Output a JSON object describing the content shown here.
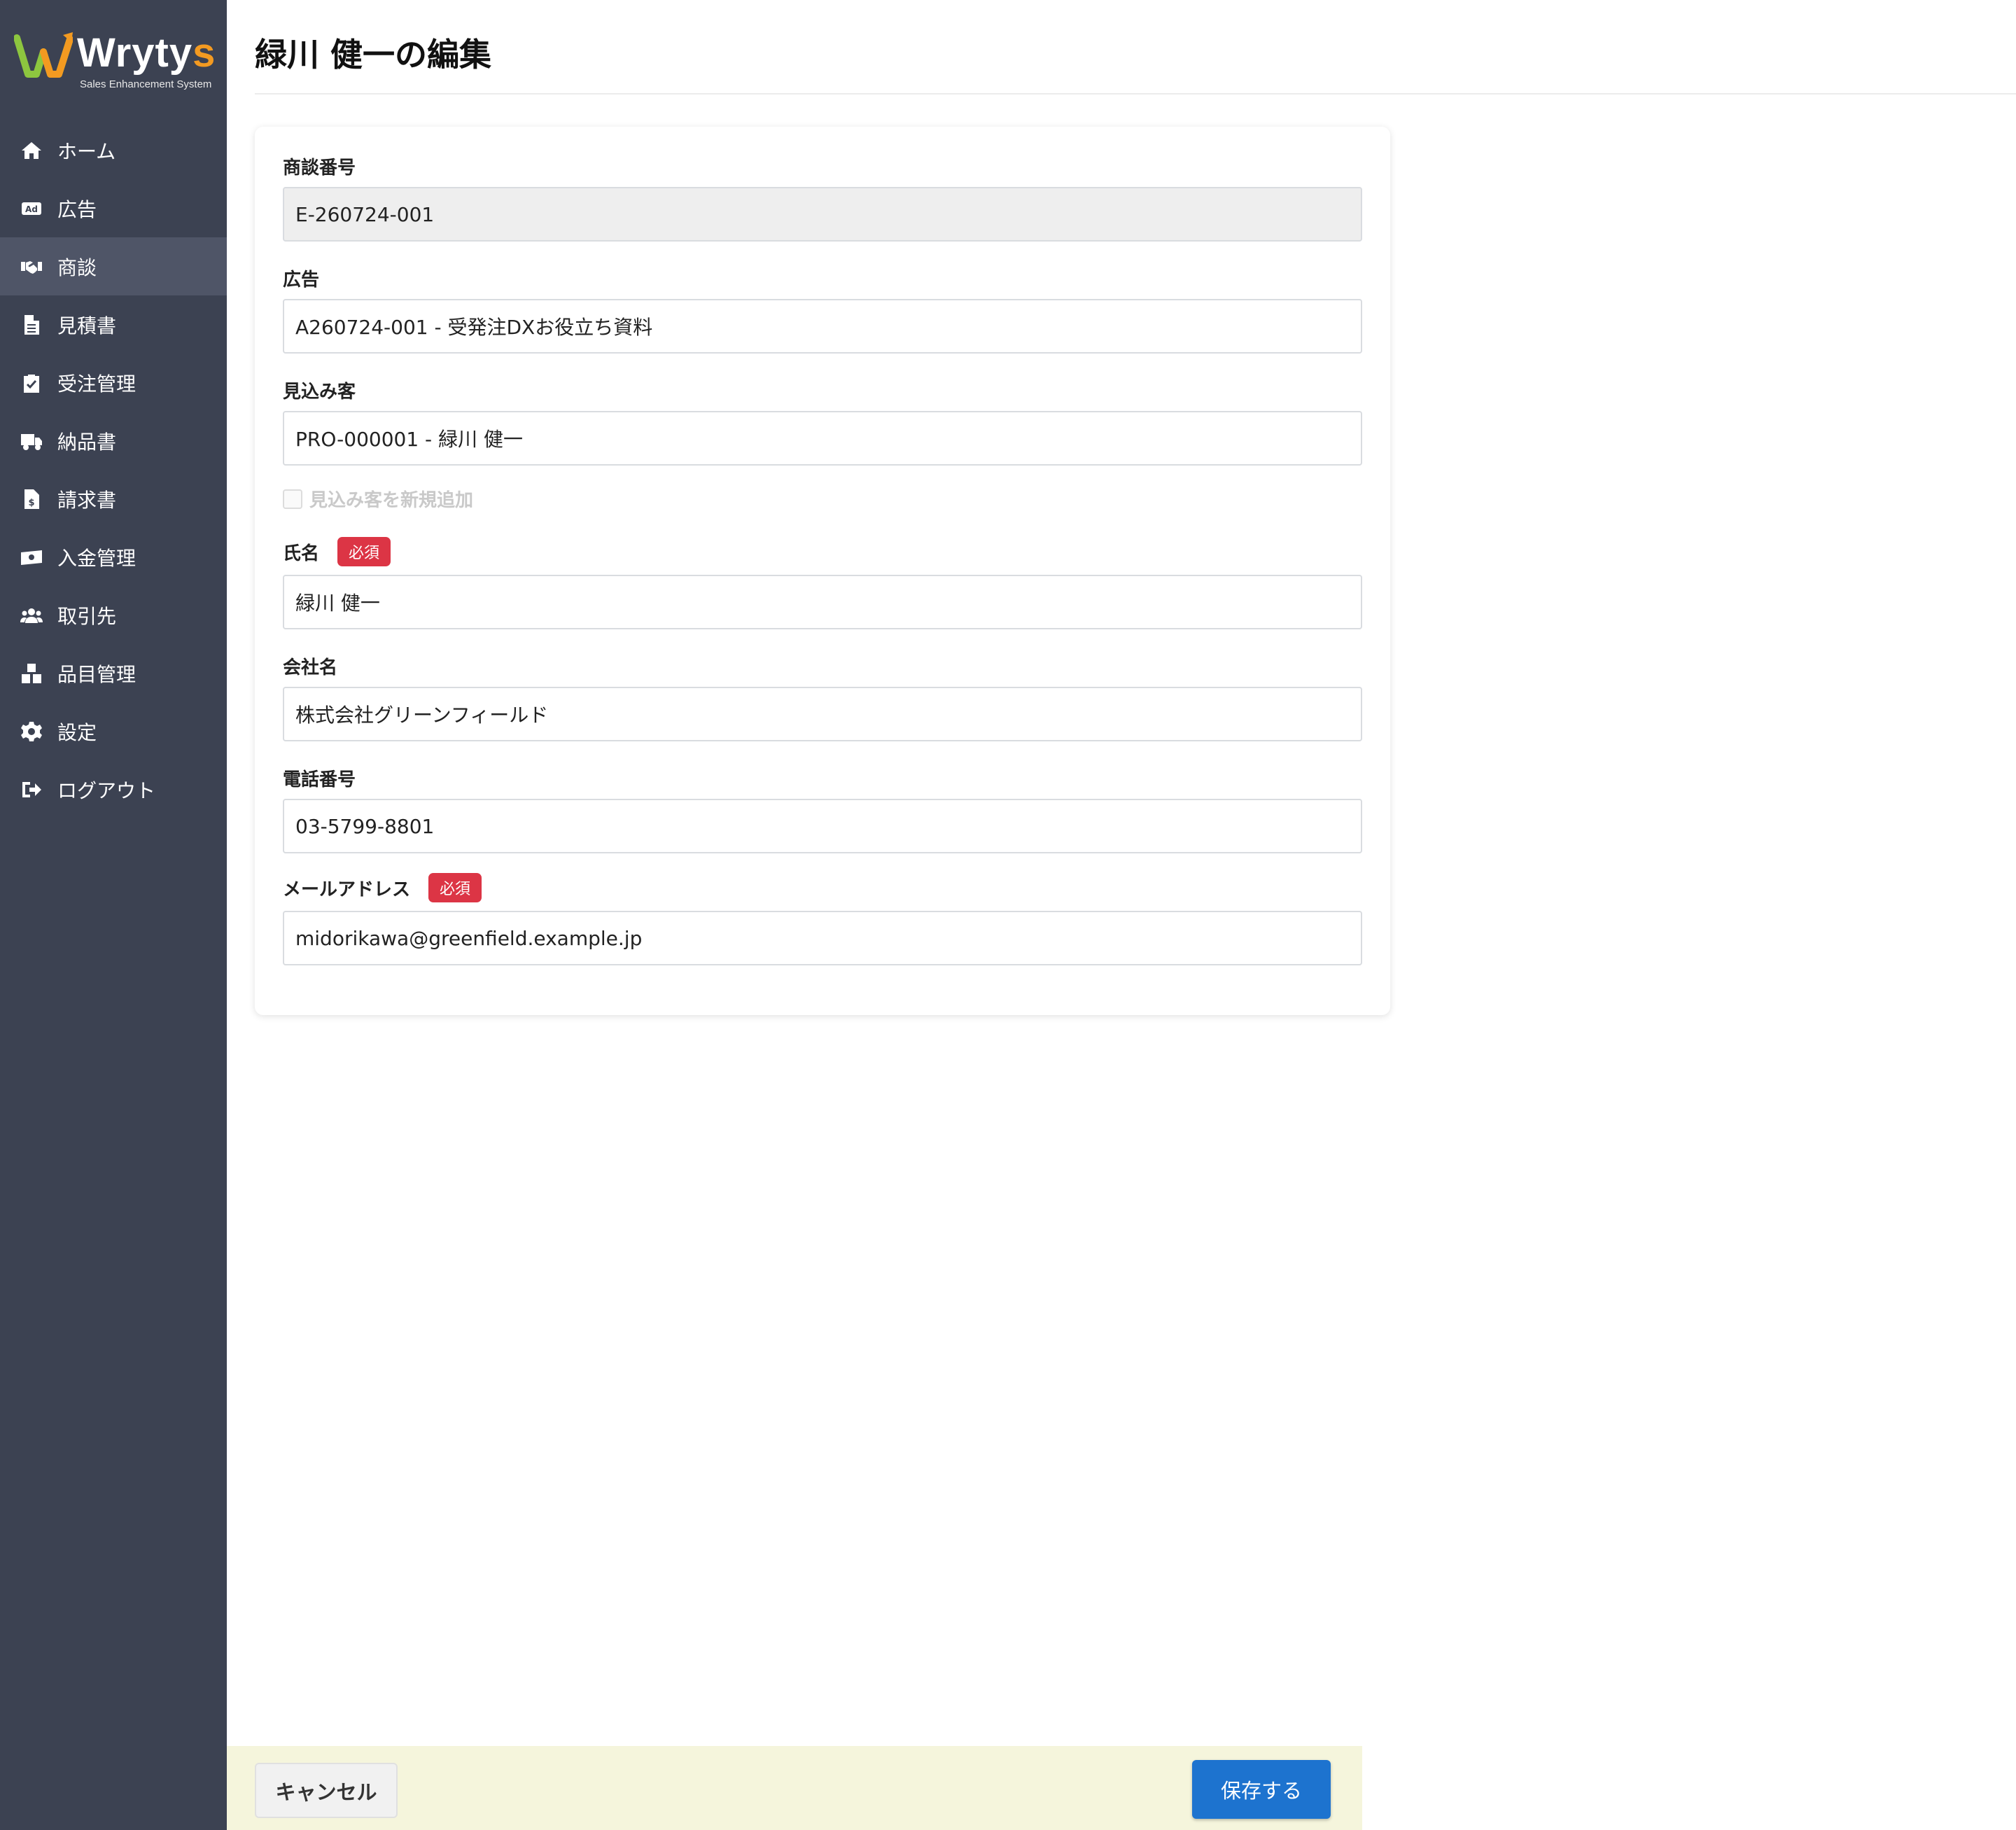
{
  "app": {
    "logo_text_main": "Wryty",
    "logo_text_accent": "s",
    "logo_subtitle": "Sales Enhancement System"
  },
  "sidebar": {
    "items": [
      {
        "label": "ホーム",
        "icon": "home-icon"
      },
      {
        "label": "広告",
        "icon": "ad-icon"
      },
      {
        "label": "商談",
        "icon": "handshake-icon",
        "active": true
      },
      {
        "label": "見積書",
        "icon": "document-icon"
      },
      {
        "label": "受注管理",
        "icon": "clipboard-check-icon"
      },
      {
        "label": "納品書",
        "icon": "truck-icon"
      },
      {
        "label": "請求書",
        "icon": "invoice-icon"
      },
      {
        "label": "入金管理",
        "icon": "money-icon"
      },
      {
        "label": "取引先",
        "icon": "users-icon"
      },
      {
        "label": "品目管理",
        "icon": "boxes-icon"
      },
      {
        "label": "設定",
        "icon": "gear-icon"
      },
      {
        "label": "ログアウト",
        "icon": "logout-icon"
      }
    ]
  },
  "page": {
    "title": "緑川 健一の編集"
  },
  "form": {
    "deal_number": {
      "label": "商談番号",
      "value": "E-260724-001"
    },
    "ad": {
      "label": "広告",
      "value": "A260724-001 - 受発注DXお役立ち資料"
    },
    "prospect": {
      "label": "見込み客",
      "value": "PRO-000001 - 緑川 健一"
    },
    "new_prospect_checkbox": {
      "label": "見込み客を新規追加",
      "checked": false
    },
    "name": {
      "label": "氏名",
      "badge": "必須",
      "value": "緑川 健一"
    },
    "company": {
      "label": "会社名",
      "value": "株式会社グリーンフィールド"
    },
    "phone": {
      "label": "電話番号",
      "value": "03-5799-8801"
    },
    "email": {
      "label": "メールアドレス",
      "badge": "必須",
      "value": "midorikawa@greenfield.example.jp"
    }
  },
  "footer": {
    "cancel_label": "キャンセル",
    "save_label": "保存する"
  },
  "colors": {
    "sidebar_bg": "#3c4252",
    "sidebar_active": "#4f5567",
    "logo_accent": "#f39a21",
    "badge_red": "#dc3545",
    "save_blue": "#1d73cf",
    "footer_bg": "#f5f5dc"
  }
}
